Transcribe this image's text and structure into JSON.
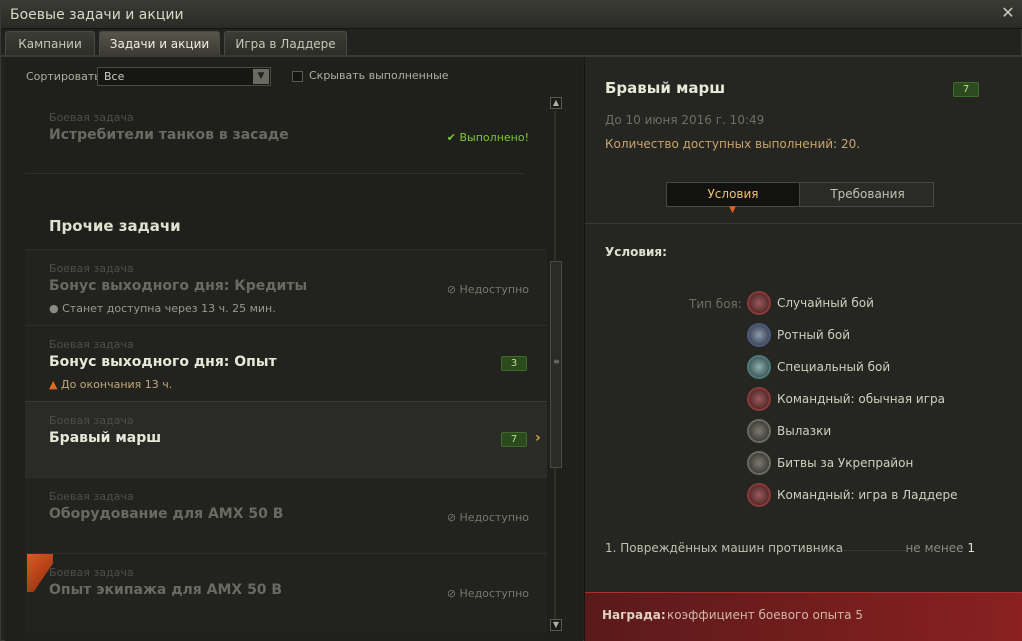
{
  "window": {
    "title": "Боевые задачи и акции"
  },
  "tabs": [
    {
      "label": "Кампании"
    },
    {
      "label": "Задачи и акции"
    },
    {
      "label": "Игра в Ладдере"
    }
  ],
  "filter": {
    "sort_label": "Сортировать:",
    "sort_value": "Все",
    "hide_done_label": "Скрывать выполненные"
  },
  "section_other": "Прочие задачи",
  "quests": [
    {
      "kind": "Боевая задача",
      "name": "Истребители танков в засаде",
      "status": "✔ Выполнено!"
    },
    {
      "kind": "Боевая задача",
      "name": "Бонус выходного дня: Кредиты",
      "status": "Недоступно",
      "note": "Станет доступна через 13 ч. 25 мин."
    },
    {
      "kind": "Боевая задача",
      "name": "Бонус выходного дня: Опыт",
      "count": "3",
      "note": "До окончания 13 ч."
    },
    {
      "kind": "Боевая задача",
      "name": "Бравый марш",
      "count": "7",
      "arrow": "›"
    },
    {
      "kind": "Боевая задача",
      "name": "Оборудование для AMX 50 B",
      "status": "Недоступно"
    },
    {
      "kind": "Боевая задача",
      "name": "Опыт экипажа для AMX 50 B",
      "status": "Недоступно"
    }
  ],
  "detail": {
    "title": "Бравый марш",
    "count": "7",
    "date": "До 10 июня 2016 г. 10:49",
    "available": "Количество доступных выполнений: 20.",
    "tab_conditions": "Условия",
    "tab_requirements": "Требования",
    "conditions_title": "Условия:",
    "battle_type_label": "Тип боя:",
    "battle_types": [
      {
        "label": "Случайный бой",
        "icon": "random-battle-icon"
      },
      {
        "label": "Ротный бой",
        "icon": "company-battle-icon"
      },
      {
        "label": "Специальный бой",
        "icon": "special-battle-icon"
      },
      {
        "label": "Командный: обычная игра",
        "icon": "team-battle-icon"
      },
      {
        "label": "Вылазки",
        "icon": "sortie-icon"
      },
      {
        "label": "Битвы за Укрепрайон",
        "icon": "stronghold-icon"
      },
      {
        "label": "Командный: игра в Ладдере",
        "icon": "ladder-battle-icon"
      }
    ],
    "criterion": {
      "text": "1. Повреждённых машин противника",
      "cond": "не менее",
      "value": "1"
    },
    "reward_label": "Награда:",
    "reward_value": "коэффициент боевого опыта 5"
  },
  "colors": {
    "accent": "#f0c070",
    "done": "#7ec83a",
    "reward_bg": "#8a2020",
    "badge": "#2b4a1e"
  }
}
